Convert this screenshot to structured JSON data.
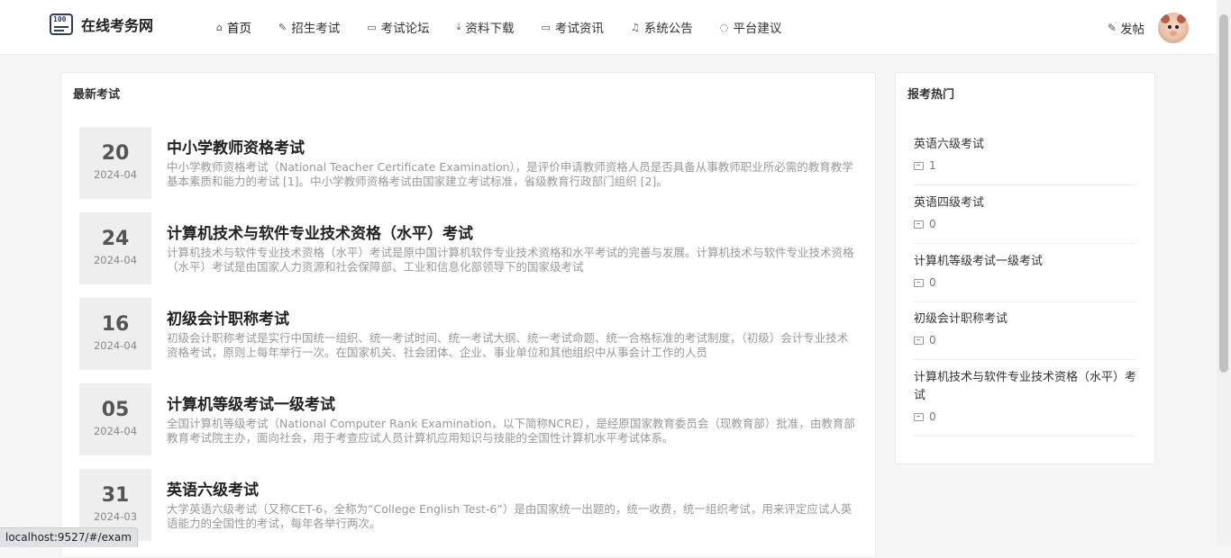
{
  "header": {
    "logo_badge": "100",
    "logo_text": "在线考务网",
    "nav": [
      {
        "label": "首页",
        "icon": "home-icon"
      },
      {
        "label": "招生考试",
        "icon": "pen-icon"
      },
      {
        "label": "考试论坛",
        "icon": "chat-icon"
      },
      {
        "label": "资料下载",
        "icon": "download-icon"
      },
      {
        "label": "考试资讯",
        "icon": "chat-icon"
      },
      {
        "label": "系统公告",
        "icon": "bell-icon"
      },
      {
        "label": "平台建议",
        "icon": "chat-icon"
      }
    ],
    "post_label": "发帖"
  },
  "main": {
    "title": "最新考试",
    "exams": [
      {
        "day": "20",
        "ym": "2024-04",
        "title": "中小学教师资格考试",
        "desc": "中小学教师资格考试（National Teacher Certificate Examination），是评价申请教师资格人员是否具备从事教师职业所必需的教育教学基本素质和能力的考试 [1]。中小学教师资格考试由国家建立考试标准，省级教育行政部门组织 [2]。"
      },
      {
        "day": "24",
        "ym": "2024-04",
        "title": "计算机技术与软件专业技术资格（水平）考试",
        "desc": "计算机技术与软件专业技术资格（水平）考试是原中国计算机软件专业技术资格和水平考试的完善与发展。计算机技术与软件专业技术资格（水平）考试是由国家人力资源和社会保障部、工业和信息化部领导下的国家级考试"
      },
      {
        "day": "16",
        "ym": "2024-04",
        "title": "初级会计职称考试",
        "desc": "初级会计职称考试是实行中国统一组织、统一考试时间、统一考试大纲、统一考试命题、统一合格标准的考试制度，（初级）会计专业技术资格考试，原则上每年举行一次。在国家机关、社会团体、企业、事业单位和其他组织中从事会计工作的人员"
      },
      {
        "day": "05",
        "ym": "2024-04",
        "title": "计算机等级考试一级考试",
        "desc": "全国计算机等级考试（National Computer Rank Examination，以下简称NCRE），是经原国家教育委员会（现教育部）批准，由教育部教育考试院主办，面向社会，用于考查应试人员计算机应用知识与技能的全国性计算机水平考试体系。"
      },
      {
        "day": "31",
        "ym": "2024-03",
        "title": "英语六级考试",
        "desc": "大学英语六级考试（又称CET-6，全称为“College English Test-6”）是由国家统一出题的，统一收费，统一组织考试，用来评定应试人英语能力的全国性的考试，每年各举行两次。"
      }
    ]
  },
  "side": {
    "title": "报考热门",
    "items": [
      {
        "name": "英语六级考试",
        "count": "1"
      },
      {
        "name": "英语四级考试",
        "count": "0"
      },
      {
        "name": "计算机等级考试一级考试",
        "count": "0"
      },
      {
        "name": "初级会计职称考试",
        "count": "0"
      },
      {
        "name": "计算机技术与软件专业技术资格（水平）考试",
        "count": "0"
      }
    ]
  },
  "status_bar": {
    "url": "localhost:9527/#/exam"
  }
}
